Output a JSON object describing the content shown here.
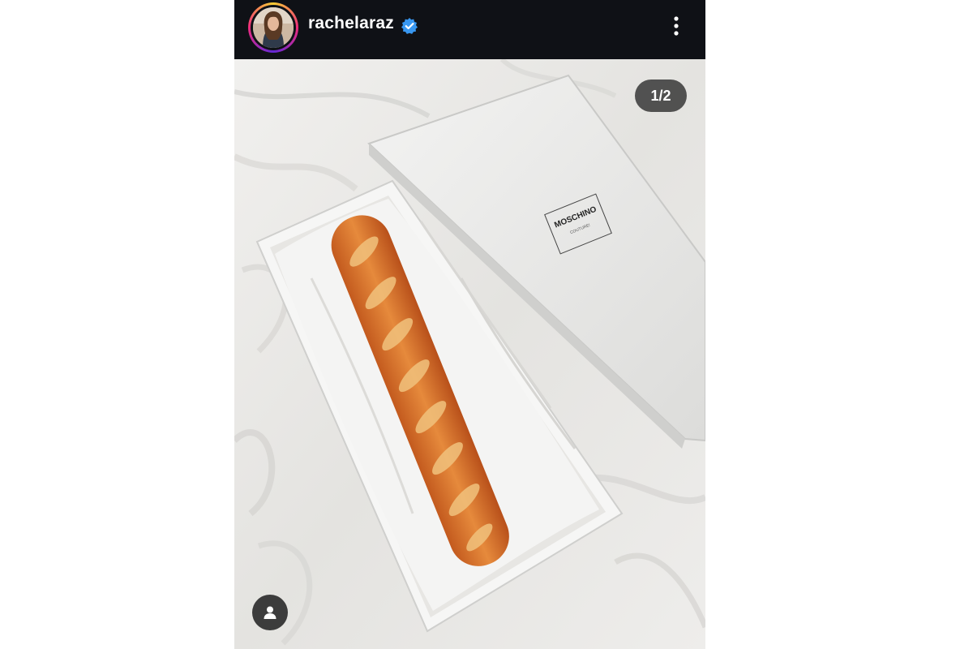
{
  "post": {
    "username": "rachelaraz",
    "verified_icon": "verified-badge-icon",
    "more_icon": "more-options-icon",
    "slide_counter": "1/2",
    "tag_icon": "person-tag-icon"
  },
  "photo": {
    "box_brand": "MOSCHINO",
    "box_subtitle": "COUTURE!"
  },
  "colors": {
    "header_bg": "#0f1116",
    "verified_blue": "#3897f0",
    "ring_yellow": "#f9ce34",
    "ring_pink": "#ee2a7b",
    "ring_purple": "#6228d7"
  }
}
